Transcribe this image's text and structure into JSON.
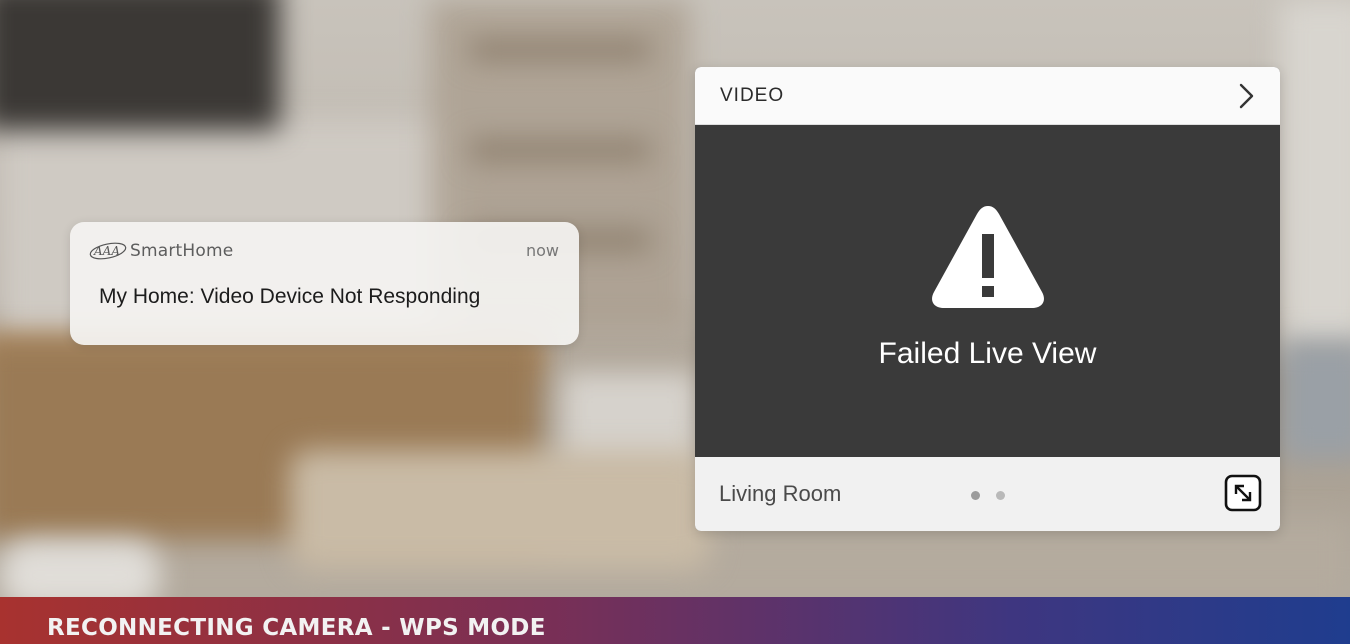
{
  "notification": {
    "app_name": "SmartHome",
    "app_logo_text": "AAA",
    "time": "now",
    "message": "My Home: Video Device Not Responding"
  },
  "video_card": {
    "title": "VIDEO",
    "status": "Failed Live View",
    "camera_name": "Living Room",
    "pages": {
      "total": 2,
      "current": 1
    },
    "icons": [
      "chevron-right-icon",
      "warning-triangle-icon",
      "expand-icon"
    ]
  },
  "banner": {
    "text": "RECONNECTING CAMERA - WPS MODE"
  },
  "colors": {
    "video_background": "#3a3a3a",
    "banner_start": "#a8322f",
    "banner_end": "#1f3d8e"
  }
}
